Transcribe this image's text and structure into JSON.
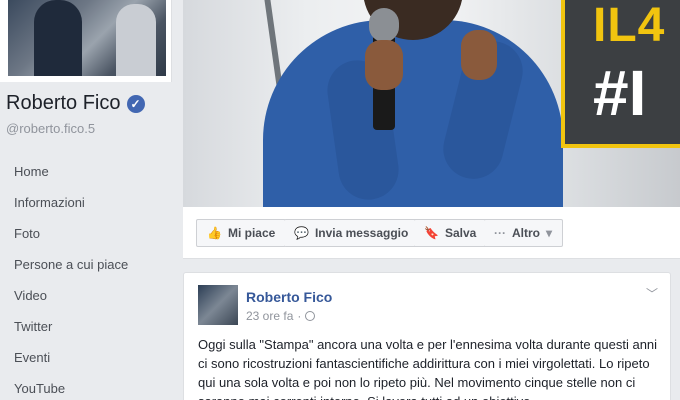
{
  "page": {
    "name": "Roberto Fico",
    "handle": "@roberto.fico.5"
  },
  "nav": {
    "items": [
      {
        "label": "Home"
      },
      {
        "label": "Informazioni"
      },
      {
        "label": "Foto"
      },
      {
        "label": "Persone a cui piace"
      },
      {
        "label": "Video"
      },
      {
        "label": "Twitter"
      },
      {
        "label": "Eventi"
      },
      {
        "label": "YouTube"
      }
    ]
  },
  "cover": {
    "banner_line1": "IL4",
    "banner_line2": "#I"
  },
  "actions": {
    "like": "Mi piace",
    "message": "Invia messaggio",
    "save": "Salva",
    "more": "Altro"
  },
  "post": {
    "author": "Roberto Fico",
    "time": "23 ore fa",
    "text": "Oggi sulla \"Stampa\" ancora una volta e per l'ennesima volta durante questi anni ci sono ricostruzioni fantascientifiche addirittura con i miei virgolettati. Lo ripeto qui una sola volta e poi non lo ripeto più. Nel movimento cinque stelle non ci saranno mai correnti interne. Si lavora tutti ad un obiettivo"
  },
  "colors": {
    "link": "#365899",
    "verified": "#4267b2",
    "banner_accent": "#f1c40f"
  }
}
